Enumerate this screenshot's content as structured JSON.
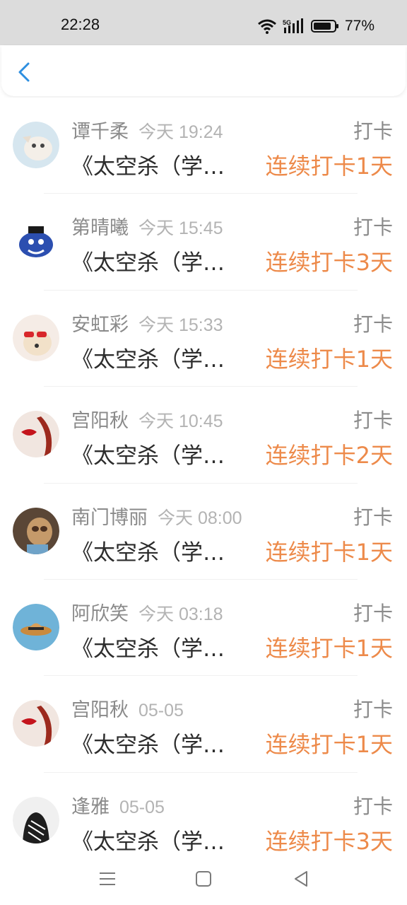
{
  "status_bar": {
    "time": "22:28",
    "battery": "77%",
    "network": "5G"
  },
  "header": {
    "back_icon": "chevron-left-icon"
  },
  "colors": {
    "accent": "#ed8a4a",
    "back": "#2e8fe0"
  },
  "records": [
    {
      "name": "谭千柔",
      "date": "今天 19:24",
      "type": "打卡",
      "title": "《太空杀（学…",
      "streak": "连续打卡1天",
      "avatar": "cat"
    },
    {
      "name": "第晴曦",
      "date": "今天 15:45",
      "type": "打卡",
      "title": "《太空杀（学…",
      "streak": "连续打卡3天",
      "avatar": "genie"
    },
    {
      "name": "安虹彩",
      "date": "今天 15:33",
      "type": "打卡",
      "title": "《太空杀（学…",
      "streak": "连续打卡1天",
      "avatar": "dog"
    },
    {
      "name": "宫阳秋",
      "date": "今天 10:45",
      "type": "打卡",
      "title": "《太空杀（学…",
      "streak": "连续打卡2天",
      "avatar": "lips"
    },
    {
      "name": "南门博丽",
      "date": "今天 08:00",
      "type": "打卡",
      "title": "《太空杀（学…",
      "streak": "连续打卡1天",
      "avatar": "sloth"
    },
    {
      "name": "阿欣笑",
      "date": "今天 03:18",
      "type": "打卡",
      "title": "《太空杀（学…",
      "streak": "连续打卡1天",
      "avatar": "hat"
    },
    {
      "name": "宫阳秋",
      "date": "05-05",
      "type": "打卡",
      "title": "《太空杀（学…",
      "streak": "连续打卡1天",
      "avatar": "lips"
    },
    {
      "name": "逢雅",
      "date": "05-05",
      "type": "打卡",
      "title": "《太空杀（学…",
      "streak": "连续打卡3天",
      "avatar": "hoodie"
    }
  ],
  "nav": {
    "menu_icon": "menu-icon",
    "home_icon": "home-icon",
    "back_icon": "back-triangle-icon"
  }
}
